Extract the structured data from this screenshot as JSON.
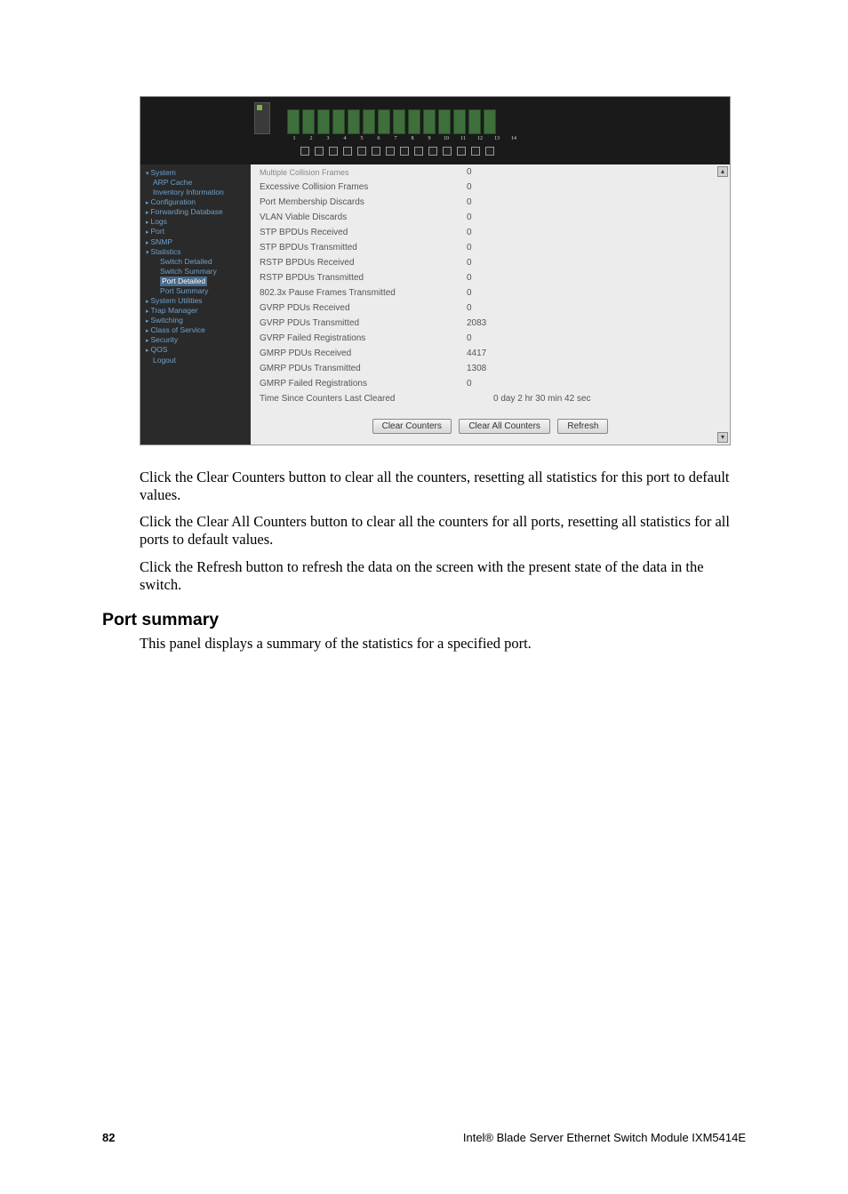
{
  "sidebar": {
    "items": [
      {
        "label": "System",
        "cls": "it tri"
      },
      {
        "label": "ARP Cache",
        "cls": "it sub plain"
      },
      {
        "label": "Inventory Information",
        "cls": "it sub plain"
      },
      {
        "label": "Configuration",
        "cls": "it triR"
      },
      {
        "label": "Forwarding Database",
        "cls": "it triR"
      },
      {
        "label": "Logs",
        "cls": "it triR"
      },
      {
        "label": "Port",
        "cls": "it triR"
      },
      {
        "label": "SNMP",
        "cls": "it triR"
      },
      {
        "label": "Statistics",
        "cls": "it tri"
      },
      {
        "label": "Switch Detailed",
        "cls": "it sub2 plain"
      },
      {
        "label": "Switch Summary",
        "cls": "it sub2 plain"
      },
      {
        "label": "Port Detailed",
        "cls": "it sub2",
        "sel": true
      },
      {
        "label": "Port Summary",
        "cls": "it sub2 plain"
      },
      {
        "label": "System Utilities",
        "cls": "it triR"
      },
      {
        "label": "Trap Manager",
        "cls": "it triR"
      },
      {
        "label": "Switching",
        "cls": "it triR"
      },
      {
        "label": "Class of Service",
        "cls": "it triR"
      },
      {
        "label": "Security",
        "cls": "it triR"
      },
      {
        "label": "QOS",
        "cls": "it triR"
      },
      {
        "label": "Logout",
        "cls": "it sub plain"
      }
    ]
  },
  "stats": [
    {
      "label": "Multiple Collision Frames",
      "value": "0"
    },
    {
      "label": "Excessive Collision Frames",
      "value": "0"
    },
    {
      "label": "Port Membership Discards",
      "value": "0"
    },
    {
      "label": "VLAN Viable Discards",
      "value": "0"
    },
    {
      "label": "STP BPDUs Received",
      "value": "0"
    },
    {
      "label": "STP BPDUs Transmitted",
      "value": "0"
    },
    {
      "label": "RSTP BPDUs Received",
      "value": "0"
    },
    {
      "label": "RSTP BPDUs Transmitted",
      "value": "0"
    },
    {
      "label": "802.3x Pause Frames Transmitted",
      "value": "0"
    },
    {
      "label": "GVRP PDUs Received",
      "value": "0"
    },
    {
      "label": "GVRP PDUs Transmitted",
      "value": "2083"
    },
    {
      "label": "GVRP Failed Registrations",
      "value": "0"
    },
    {
      "label": "GMRP PDUs Received",
      "value": "4417"
    },
    {
      "label": "GMRP PDUs Transmitted",
      "value": "1308"
    },
    {
      "label": "GMRP Failed Registrations",
      "value": "0"
    },
    {
      "label": "Time Since Counters Last Cleared",
      "value": "0 day 2 hr 30 min 42 sec"
    }
  ],
  "port_numbers": [
    "1",
    "2",
    "3",
    "4",
    "5",
    "6",
    "7",
    "8",
    "9",
    "10",
    "11",
    "12",
    "13",
    "14"
  ],
  "buttons": {
    "clear_counters": "Clear Counters",
    "clear_all": "Clear All Counters",
    "refresh": "Refresh"
  },
  "paragraphs": {
    "p1": "Click the Clear Counters button to clear all the counters, resetting all statistics for this port to default values.",
    "p2": "Click the Clear All Counters button to clear all the counters for all ports, resetting all statistics for all ports to default values.",
    "p3": "Click the Refresh button to refresh the data on the screen with the present state of the data in the switch."
  },
  "heading": "Port summary",
  "heading_desc": "This panel displays a summary of the statistics for a specified port.",
  "footer": {
    "page": "82",
    "title": "Intel® Blade Server Ethernet Switch Module IXM5414E"
  }
}
